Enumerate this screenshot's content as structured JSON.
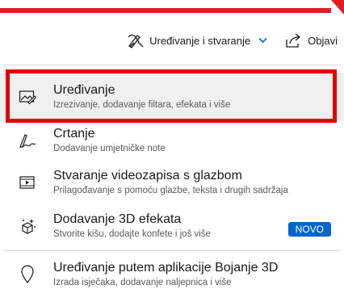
{
  "toolbar": {
    "edit_create_label": "Uređivanje i stvaranje",
    "share_label": "Objavi"
  },
  "menu": {
    "items": [
      {
        "label": "Uređivanje",
        "description": "Izrezivanje, dodavanje filtara, efekata i više",
        "icon": "image-edit-icon"
      },
      {
        "label": "Crtanje",
        "description": "Dodavanje umjetničke note",
        "icon": "pen-draw-icon"
      },
      {
        "label": "Stvaranje videozapisa s glazbom",
        "description": "Prilagođavanje s pomoću glazbe, teksta i drugih sadržaja",
        "icon": "video-music-icon"
      },
      {
        "label": "Dodavanje 3D efekata",
        "description": "Stvorite kišu, dodajte konfete i još više",
        "icon": "3d-effects-icon",
        "badge": "NOVO"
      },
      {
        "label": "Uređivanje putem aplikacije Bojanje 3D",
        "description": "Izrada isječaka, dodavanje naljepnica i više",
        "icon": "paint3d-icon"
      }
    ]
  },
  "colors": {
    "highlight_border": "#e00000",
    "badge_bg": "#0066cc",
    "accent": "#0066cc"
  }
}
